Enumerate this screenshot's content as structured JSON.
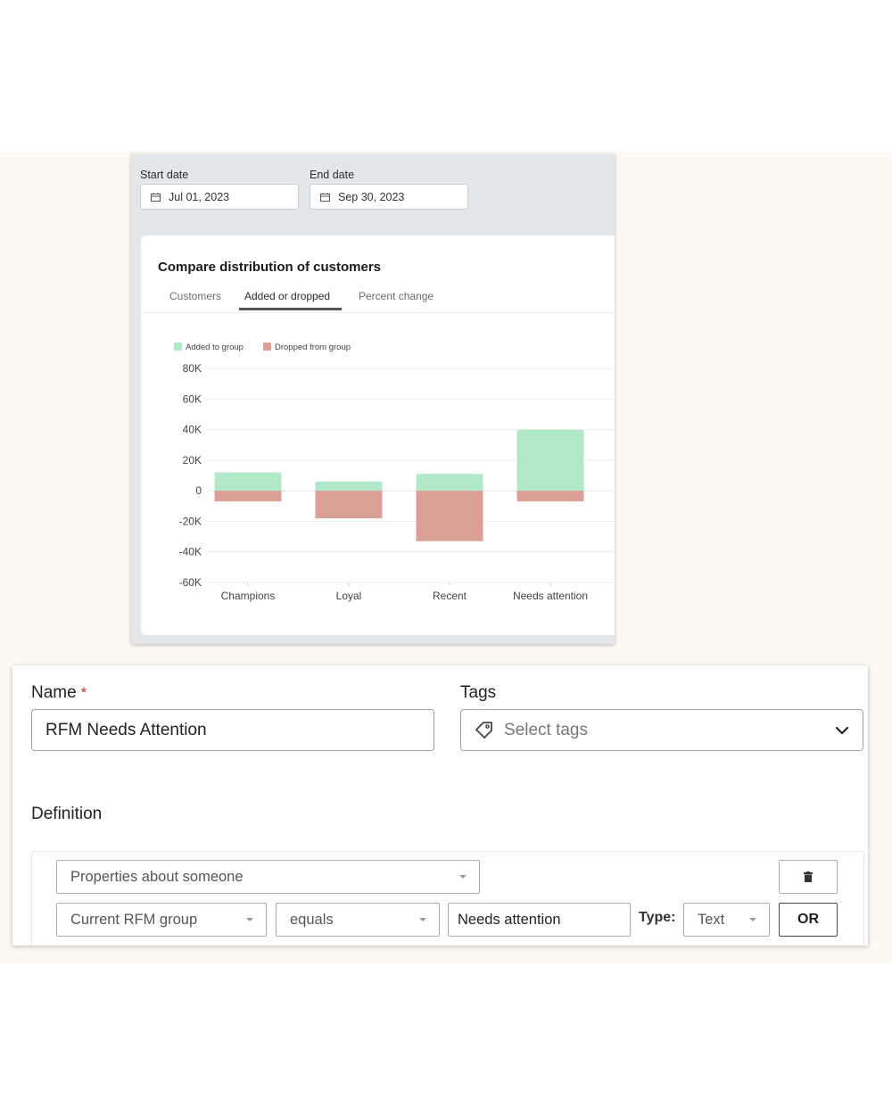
{
  "dates": {
    "start_label": "Start date",
    "start_value": "Jul 01, 2023",
    "end_label": "End date",
    "end_value": "Sep 30, 2023"
  },
  "chart_card": {
    "title": "Compare distribution of customers",
    "tabs": [
      {
        "label": "Customers",
        "active": false
      },
      {
        "label": "Added or dropped",
        "active": true
      },
      {
        "label": "Percent change",
        "active": false
      }
    ]
  },
  "chart_data": {
    "type": "bar",
    "stacked": true,
    "categories": [
      "Champions",
      "Loyal",
      "Recent",
      "Needs attention"
    ],
    "series": [
      {
        "name": "Added to group",
        "color": "#b1e8c7",
        "values": [
          12000,
          6000,
          11000,
          40000
        ]
      },
      {
        "name": "Dropped from group",
        "color": "#dba095",
        "values": [
          -7000,
          -18000,
          -33000,
          -7000
        ]
      }
    ],
    "ylim": [
      -60000,
      80000
    ],
    "yticks": [
      80000,
      60000,
      40000,
      20000,
      0,
      -20000,
      -40000,
      -60000
    ],
    "ytick_labels": [
      "80K",
      "60K",
      "40K",
      "20K",
      "0",
      "-20K",
      "-40K",
      "-60K"
    ],
    "grid": true,
    "legend_position": "top-left"
  },
  "form": {
    "name_label": "Name",
    "name_required_mark": "*",
    "name_value": "RFM Needs Attention",
    "tags_label": "Tags",
    "tags_placeholder": "Select tags",
    "definition_label": "Definition",
    "condition_type": "Properties about someone",
    "property": "Current RFM group",
    "operator": "equals",
    "value": "Needs attention",
    "type_label": "Type:",
    "type_value": "Text",
    "or_label": "OR"
  },
  "icons": {
    "date": "calendar-icon",
    "tags": "tag-icon",
    "dropdown": "chevron-down-icon",
    "delete": "trash-icon"
  }
}
